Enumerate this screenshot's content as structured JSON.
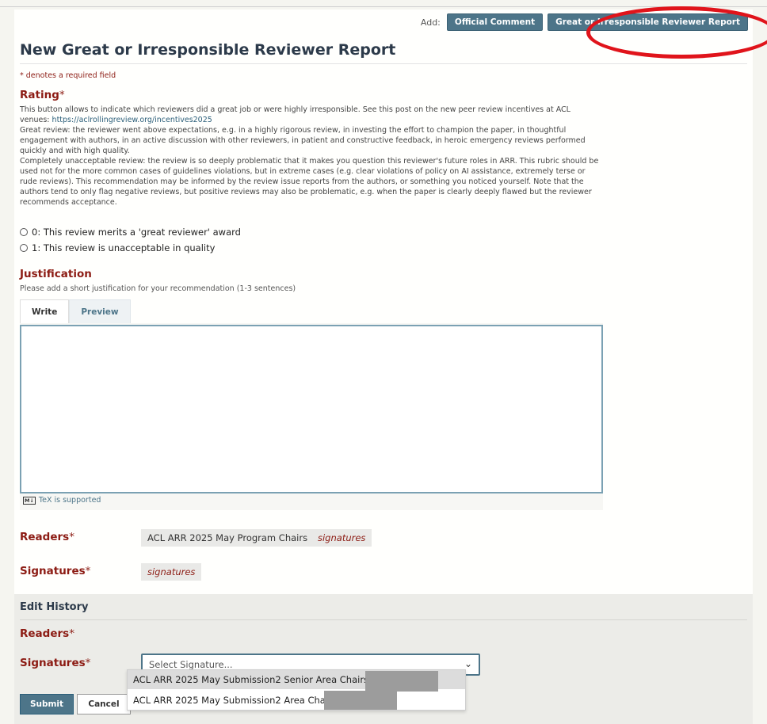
{
  "addbar": {
    "label": "Add:",
    "official_comment": "Official Comment",
    "report_button": "Great or Irresponsible Reviewer Report"
  },
  "form": {
    "title": "New Great or Irresponsible Reviewer Report",
    "required_note": "* denotes a required field",
    "rating": {
      "label": "Rating",
      "star": "*",
      "desc_1": "This button allows to indicate which reviewers did a great job or were highly irresponsible. See this post on the new peer review incentives at ACL venues:",
      "link": "https://aclrollingreview.org/incentives2025",
      "desc_2": "Great review: the reviewer went above expectations, e.g. in a highly rigorous review, in investing the effort to champion the paper, in thoughtful engagement with authors, in an active discussion with other reviewers, in patient and constructive feedback, in heroic emergency reviews performed quickly and with high quality.",
      "desc_3": "Completely unacceptable review: the review is so deeply problematic that it makes you question this reviewer's future roles in ARR. This rubric should be used not for the more common cases of guidelines violations, but in extreme cases (e.g. clear violations of policy on AI assistance, extremely terse or rude reviews). This recommendation may be informed by the review issue reports from the authors, or something you noticed yourself. Note that the authors tend to only flag negative reviews, but positive reviews may also be problematic, e.g. when the paper is clearly deeply flawed but the reviewer recommends acceptance.",
      "options": [
        "0: This review merits a 'great reviewer' award",
        "1: This review is unacceptable in quality"
      ]
    },
    "justification": {
      "label": "Justification",
      "star": "*",
      "help": "Please add a short justification for your recommendation (1-3 sentences)",
      "tab_write": "Write",
      "tab_preview": "Preview",
      "tex_note": "TeX is supported",
      "md_icon": "M↓"
    },
    "readers": {
      "label": "Readers",
      "star": "*",
      "chip_1": "ACL ARR 2025 May Program Chairs",
      "chip_2": "signatures"
    },
    "signatures": {
      "label": "Signatures",
      "star": "*",
      "chip_1": "signatures"
    }
  },
  "history": {
    "title": "Edit History",
    "readers_label": "Readers",
    "signatures_label": "Signatures",
    "star": "*",
    "select_placeholder": "Select Signature...",
    "chevron": "⌄",
    "options": [
      "ACL ARR 2025 May Submission2 Senior Area Chairs (",
      "ACL ARR 2025 May Submission2 Area Chair"
    ],
    "option_1_suffix": ")"
  },
  "actions": {
    "submit": "Submit",
    "cancel": "Cancel"
  }
}
